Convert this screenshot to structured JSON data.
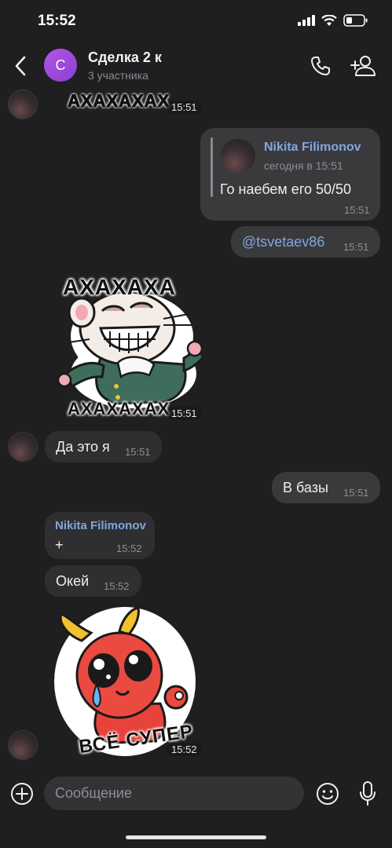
{
  "status_bar": {
    "time": "15:52"
  },
  "header": {
    "avatar_letter": "С",
    "title": "Сделка 2 к",
    "subtitle": "3 участника"
  },
  "messages": {
    "m1": {
      "sticker_text": "АХАХАХАХ",
      "time": "15:51"
    },
    "m2": {
      "reply_author": "Nikita Filimonov",
      "reply_time": "сегодня в 15:51",
      "text": "Го наебем его 50/50",
      "time": "15:51"
    },
    "m3": {
      "text": "@tsvetaev86",
      "time": "15:51"
    },
    "m4": {
      "sticker_top": "АХАХАХА",
      "sticker_bottom": "АХАХАХАХ",
      "time": "15:51"
    },
    "m5": {
      "text": "Да это я",
      "time": "15:51"
    },
    "m6": {
      "text": "В базы",
      "time": "15:51"
    },
    "m7": {
      "author": "Nikita Filimonov",
      "text": "+",
      "time": "15:52"
    },
    "m8": {
      "text": "Окей",
      "time": "15:52"
    },
    "m9": {
      "sticker_text": "ВСЁ СУПЕР",
      "time": "15:52"
    }
  },
  "composer": {
    "placeholder": "Сообщение"
  },
  "colors": {
    "background": "#1f1f21",
    "bubble": "#2f2f31",
    "link": "#7fa7e0",
    "avatar": "#a94fe0"
  },
  "icons": [
    "back-icon",
    "phone-icon",
    "add-person-icon",
    "plus-circle-icon",
    "smile-icon",
    "mic-icon"
  ]
}
